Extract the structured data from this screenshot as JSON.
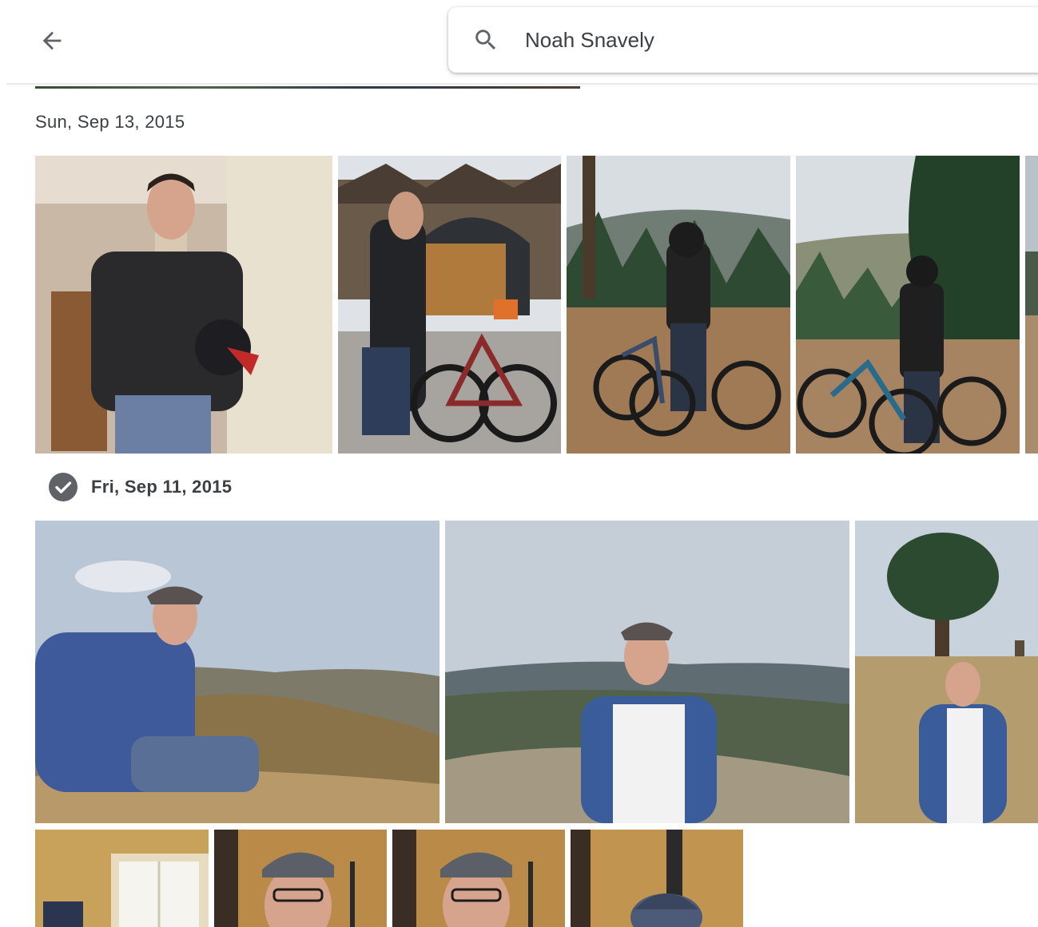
{
  "search": {
    "query": "Noah Snavely"
  },
  "sections": [
    {
      "date": "Sun, Sep 13, 2015"
    },
    {
      "date": "Fri, Sep 11, 2015"
    }
  ],
  "icons": {
    "back": "arrow-back-icon",
    "search": "search-icon",
    "select": "check-circle-icon"
  },
  "colors": {
    "icon_gray": "#5f6368",
    "text": "#3c4043",
    "background": "#ffffff"
  }
}
